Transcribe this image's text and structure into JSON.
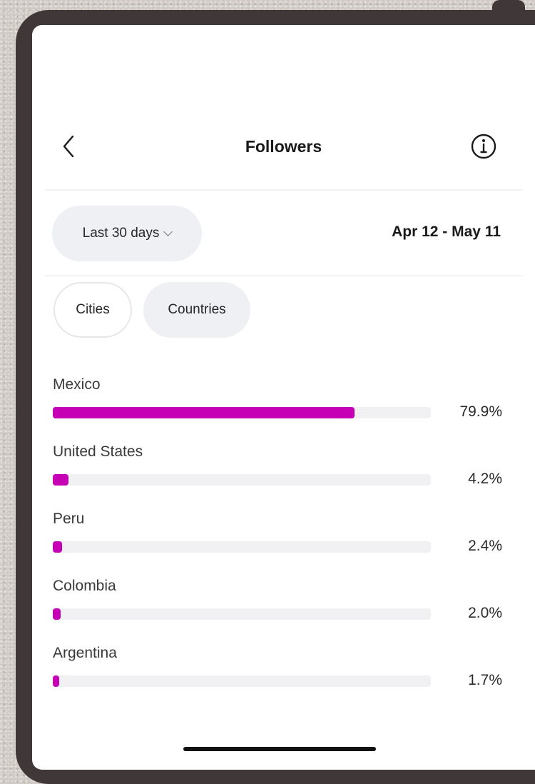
{
  "header": {
    "title": "Followers",
    "back_icon": "chevron-left-icon",
    "info_icon": "info-icon"
  },
  "filters": {
    "range_label": "Last 30 days",
    "range_icon": "chevron-down-icon",
    "date_range": "Apr 12 - May 11"
  },
  "tabs": [
    {
      "label": "Cities",
      "selected": false
    },
    {
      "label": "Countries",
      "selected": true
    }
  ],
  "colors": {
    "bar_fill": "#c500b5",
    "bar_track": "#f1f1f4",
    "pill_bg": "#eef0f3",
    "device_frame": "#403838"
  },
  "chart_data": {
    "type": "bar",
    "categories": [
      "Mexico",
      "United States",
      "Peru",
      "Colombia",
      "Argentina"
    ],
    "values": [
      79.9,
      4.2,
      2.4,
      2.0,
      1.7
    ],
    "value_labels": [
      "79.9%",
      "4.2%",
      "2.4%",
      "2.0%",
      "1.7%"
    ]
  }
}
